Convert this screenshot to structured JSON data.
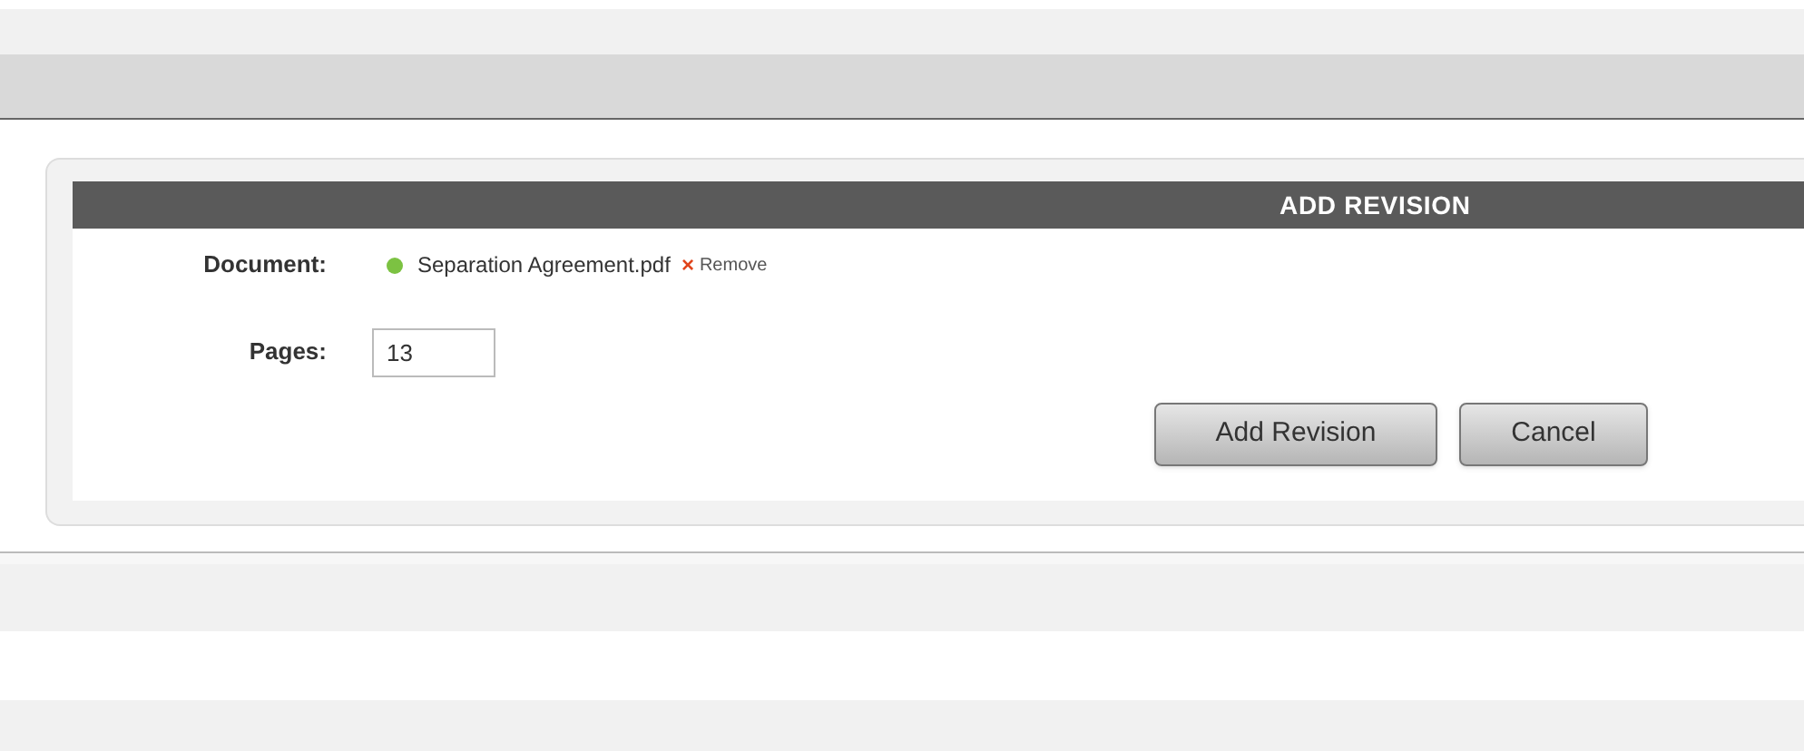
{
  "panel": {
    "title": "ADD REVISION",
    "document": {
      "label": "Document:",
      "file_name": "Separation Agreement.pdf",
      "remove_icon": "×",
      "remove_label": "Remove"
    },
    "pages": {
      "label": "Pages:",
      "value": "13"
    },
    "buttons": [
      "Add Revision",
      "Cancel"
    ]
  }
}
